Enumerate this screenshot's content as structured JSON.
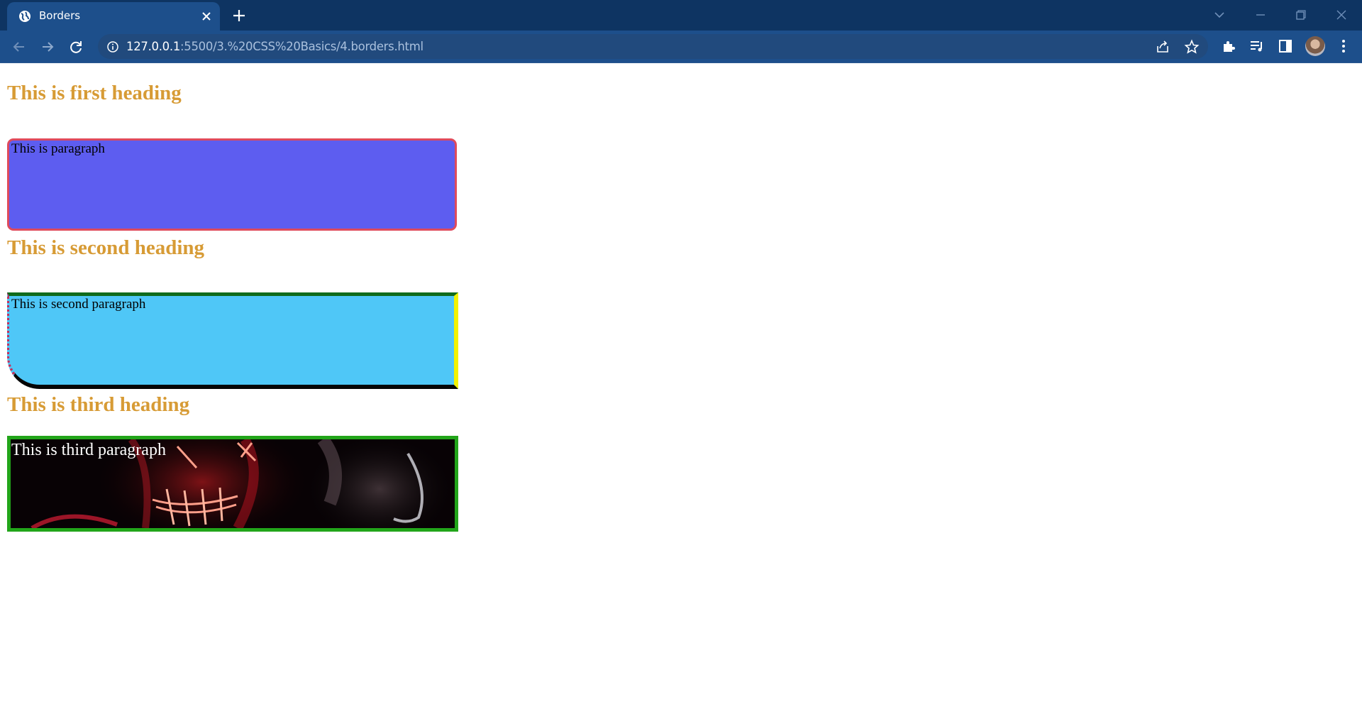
{
  "browser": {
    "tab_title": "Borders",
    "url_host": "127.0.0.1",
    "url_path": ":5500/3.%20CSS%20Basics/4.borders.html"
  },
  "page": {
    "heading1": "This is first heading",
    "paragraph1": "This is paragraph",
    "heading2": "This is second heading",
    "paragraph2": "This is second paragraph",
    "heading3": "This is third heading",
    "paragraph3": "This is third paragraph"
  },
  "colors": {
    "heading": "#d79b35",
    "p1_bg": "#5d5df0",
    "p1_border": "#df4a5c",
    "p2_bg": "#4fc7f7",
    "p3_border": "#22a51a"
  }
}
